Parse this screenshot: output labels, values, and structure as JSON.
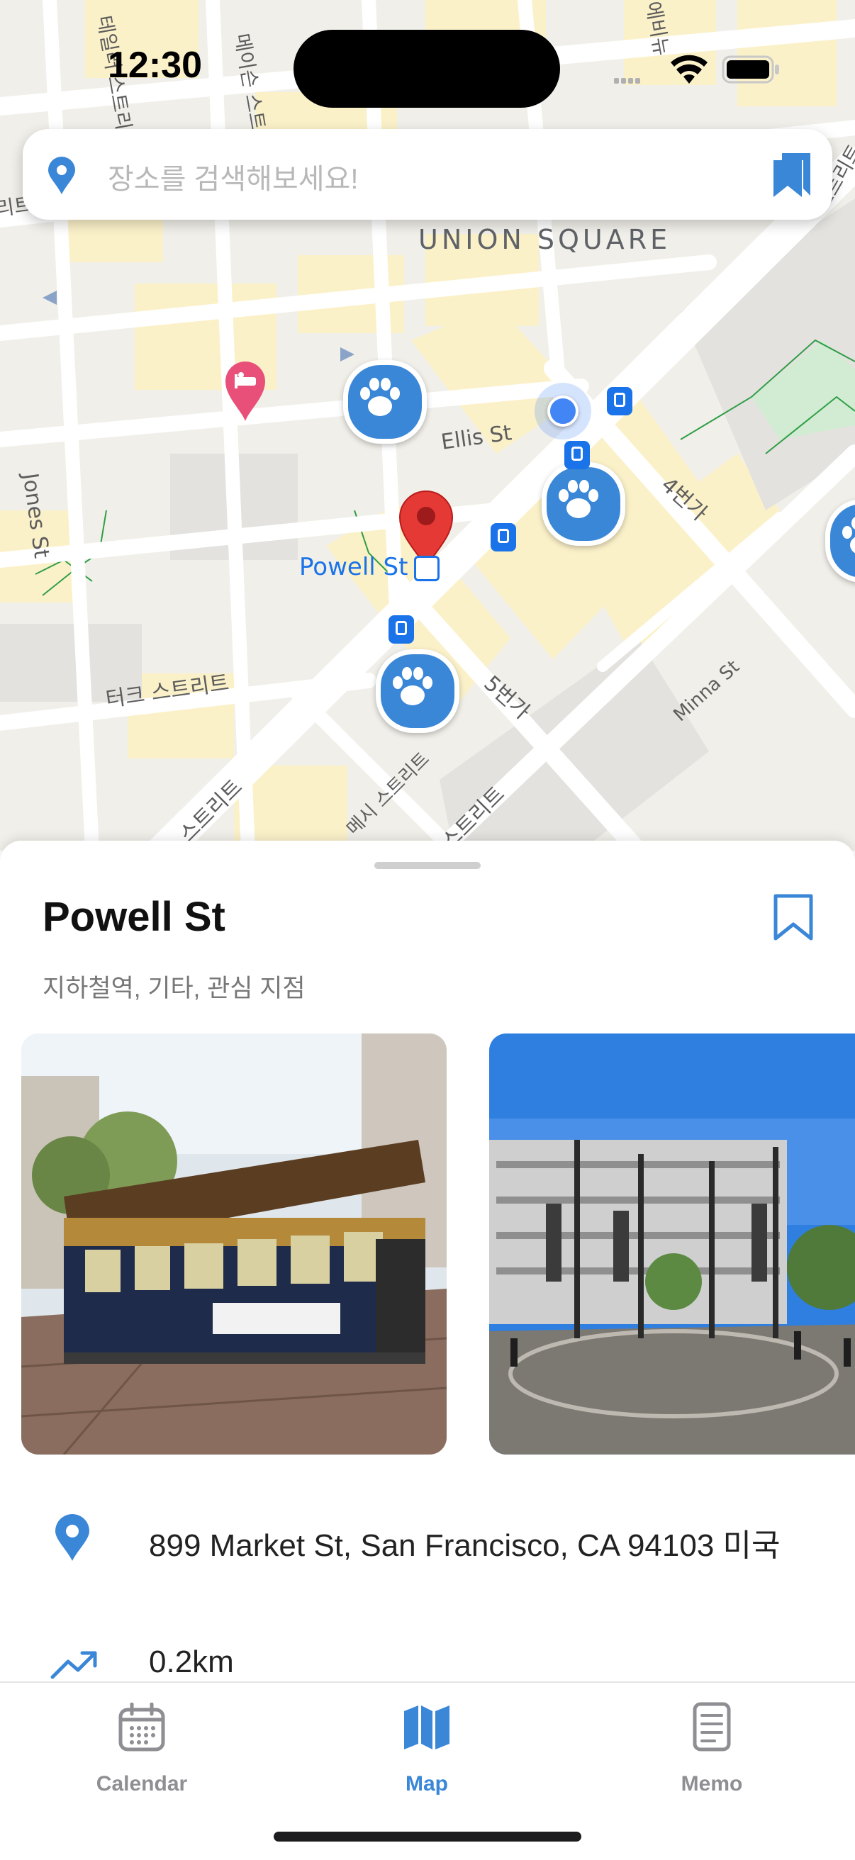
{
  "status_bar": {
    "time": "12:30"
  },
  "search": {
    "placeholder": "장소를 검색해보세요!"
  },
  "map": {
    "district": "UNION SQUARE",
    "streets": {
      "ellis": "Ellis St",
      "jones": "Jones St",
      "turk": "터크 스트리트",
      "fourth": "4번가",
      "fifth": "5번가",
      "minna": "Minna St",
      "taylor": "테일러 스트리트",
      "mason": "메이슨 스트",
      "left_bottom": "스트리트",
      "mid_bottom": "메시 스트리트",
      "right_bottom": "스트리트",
      "top_right": "에비뉴",
      "top_far_right": "스트리트",
      "left_top": "리트"
    },
    "station_label": "Powell St"
  },
  "place": {
    "name": "Powell St",
    "categories": "지하철역, 기타, 관심 지점",
    "address": "899 Market St, San Francisco, CA 94103 미국",
    "distance": "0.2km"
  },
  "tabs": [
    {
      "label": "Calendar",
      "icon": "calendar-icon",
      "active": false
    },
    {
      "label": "Map",
      "icon": "map-icon",
      "active": true
    },
    {
      "label": "Memo",
      "icon": "memo-icon",
      "active": false
    }
  ],
  "colors": {
    "accent": "#3a87d8",
    "inactive": "#8e8e93",
    "pin": "#e53935",
    "hotel": "#e8507a"
  }
}
